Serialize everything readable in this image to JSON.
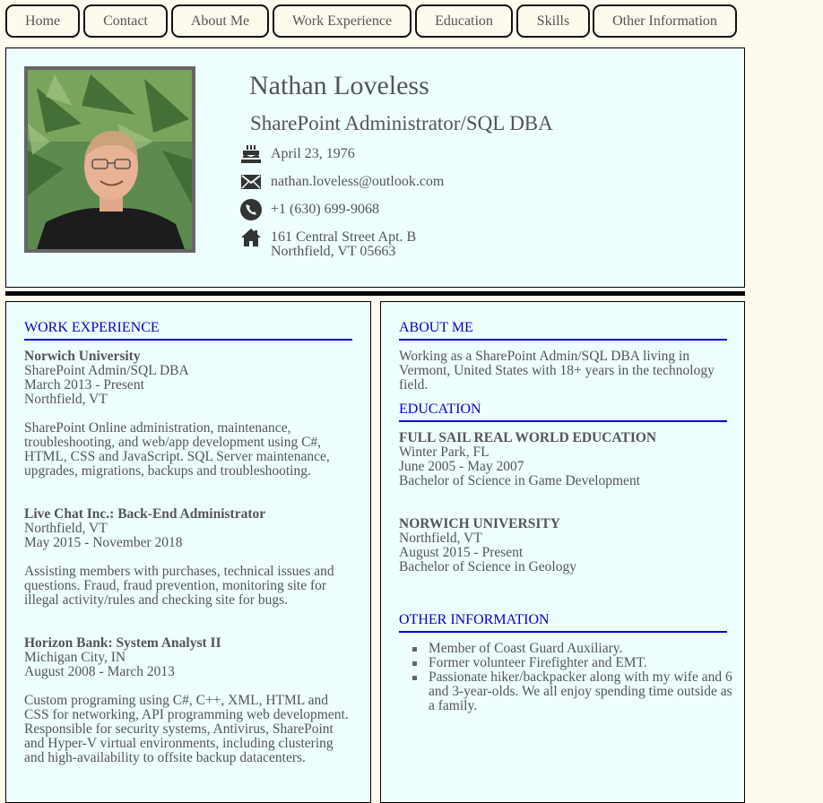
{
  "nav": {
    "items": [
      {
        "label": "Home"
      },
      {
        "label": "Contact"
      },
      {
        "label": "About Me"
      },
      {
        "label": "Work Experience"
      },
      {
        "label": "Education"
      },
      {
        "label": "Skills"
      },
      {
        "label": "Other Information"
      }
    ]
  },
  "profile": {
    "name": "Nathan Loveless",
    "title": "SharePoint Administrator/SQL DBA",
    "birthday": "April 23, 1976",
    "email": "nathan.loveless@outlook.com",
    "phone": "+1 (630) 699-9068",
    "address_line1": "161 Central Street Apt. B",
    "address_line2": "Northfield, VT 05663"
  },
  "work": {
    "heading": "WORK EXPERIENCE",
    "jobs": [
      {
        "employer": "Norwich University",
        "role": "SharePoint Admin/SQL DBA",
        "dates": "March 2013 - Present",
        "location": "Northfield, VT",
        "description": "SharePoint Online administration, maintenance, troubleshooting, and web/app development using C#, HTML, CSS and JavaScript. SQL Server maintenance, upgrades, migrations, backups and troubleshooting."
      },
      {
        "employer": "Live Chat Inc.: Back-End Administrator",
        "location": "Northfield, VT",
        "dates": "May 2015 - November 2018",
        "description": "Assisting members with purchases, technical issues and questions. Fraud, fraud prevention, monitoring site for illegal activity/rules and checking site for bugs."
      },
      {
        "employer": "Horizon Bank: System Analyst II",
        "location": "Michigan City, IN",
        "dates": "August 2008 - March 2013",
        "description": "Custom programing using C#, C++, XML, HTML and CSS for networking, API programming web development. Responsible for security systems, Antivirus, SharePoint and Hyper-V virtual environments, including clustering and high-availability to offsite backup datacenters."
      }
    ]
  },
  "about": {
    "heading": "ABOUT ME",
    "text": "Working as a SharePoint Admin/SQL DBA living in Vermont, United States with 18+ years in the technology field."
  },
  "education": {
    "heading": "EDUCATION",
    "schools": [
      {
        "name": "FULL SAIL REAL WORLD EDUCATION",
        "location": "Winter Park, FL",
        "dates": "June 2005 - May 2007",
        "degree": "Bachelor of Science in Game Development"
      },
      {
        "name": "NORWICH UNIVERSITY",
        "location": "Northfield, VT",
        "dates": "August 2015 - Present",
        "degree": "Bachelor of Science in Geology"
      }
    ]
  },
  "other": {
    "heading": "OTHER INFORMATION",
    "items": [
      "Member of Coast Guard Auxiliary.",
      "Former volunteer Firefighter and EMT.",
      "Passionate hiker/backpacker along with my wife and 6 and 3-year-olds. We all enjoy spending time outside as a family."
    ]
  },
  "icons": {
    "birthday": "birthday-cake-icon",
    "email": "envelope-icon",
    "phone": "phone-icon",
    "address": "home-icon"
  },
  "colors": {
    "background": "#fffaee",
    "panel": "#efffff",
    "heading_blue": "#0000cc",
    "text": "#555555"
  }
}
